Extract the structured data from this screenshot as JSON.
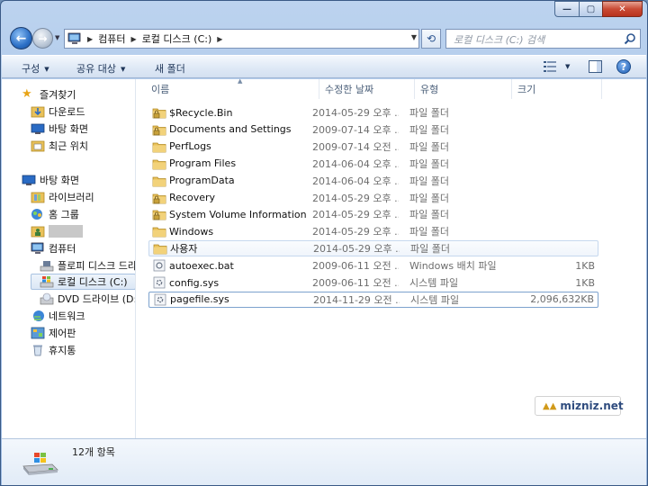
{
  "window": {
    "caption": {
      "min": "—",
      "max": "▢",
      "close": "✕"
    }
  },
  "nav": {
    "back": "←",
    "forward": "→",
    "address_crumbs": [
      "컴퓨터",
      "로컬 디스크 (C:)"
    ],
    "refresh": "⟲",
    "search_placeholder": "로컬 디스크 (C:) 검색"
  },
  "commandbar": {
    "organize": "구성",
    "share": "공유 대상",
    "new_folder": "새 폴더"
  },
  "sidebar": {
    "favorites": {
      "label": "즐겨찾기",
      "items": [
        "다운로드",
        "바탕 화면",
        "최근 위치"
      ]
    },
    "desktop": {
      "label": "바탕 화면",
      "items": [
        "라이브러리",
        "홈 그룹"
      ]
    },
    "computer": {
      "label": "컴퓨터",
      "items": [
        "플로피 디스크 드라이브 (A:)",
        "로컬 디스크 (C:)",
        "DVD 드라이브 (D:)"
      ]
    },
    "network": "네트워크",
    "control_panel": "제어판",
    "recycle_bin": "휴지통"
  },
  "columns": {
    "name": "이름",
    "date": "수정한 날짜",
    "type": "유형",
    "size": "크기"
  },
  "files": [
    {
      "name": "$Recycle.Bin",
      "date": "2014-05-29 오후 ...",
      "type": "파일 폴더",
      "size": "",
      "icon": "locked-folder-icon"
    },
    {
      "name": "Documents and Settings",
      "date": "2009-07-14 오후 ...",
      "type": "파일 폴더",
      "size": "",
      "icon": "locked-folder-icon"
    },
    {
      "name": "PerfLogs",
      "date": "2009-07-14 오전 ...",
      "type": "파일 폴더",
      "size": "",
      "icon": "folder-icon"
    },
    {
      "name": "Program Files",
      "date": "2014-06-04 오후 ...",
      "type": "파일 폴더",
      "size": "",
      "icon": "folder-icon"
    },
    {
      "name": "ProgramData",
      "date": "2014-06-04 오후 ...",
      "type": "파일 폴더",
      "size": "",
      "icon": "folder-icon"
    },
    {
      "name": "Recovery",
      "date": "2014-05-29 오후 ...",
      "type": "파일 폴더",
      "size": "",
      "icon": "locked-folder-icon"
    },
    {
      "name": "System Volume Information",
      "date": "2014-05-29 오후 ...",
      "type": "파일 폴더",
      "size": "",
      "icon": "locked-folder-icon"
    },
    {
      "name": "Windows",
      "date": "2014-05-29 오후 ...",
      "type": "파일 폴더",
      "size": "",
      "icon": "folder-icon"
    },
    {
      "name": "사용자",
      "date": "2014-05-29 오후 ...",
      "type": "파일 폴더",
      "size": "",
      "icon": "folder-icon"
    },
    {
      "name": "autoexec.bat",
      "date": "2009-06-11 오전 ...",
      "type": "Windows 배치 파일",
      "size": "1KB",
      "icon": "batch-file-icon"
    },
    {
      "name": "config.sys",
      "date": "2009-06-11 오전 ...",
      "type": "시스템 파일",
      "size": "1KB",
      "icon": "system-file-icon"
    },
    {
      "name": "pagefile.sys",
      "date": "2014-11-29 오전 ...",
      "type": "시스템 파일",
      "size": "2,096,632KB",
      "icon": "system-file-icon"
    }
  ],
  "watermark": "mizniz.net",
  "details": {
    "item_count": "12개 항목"
  }
}
